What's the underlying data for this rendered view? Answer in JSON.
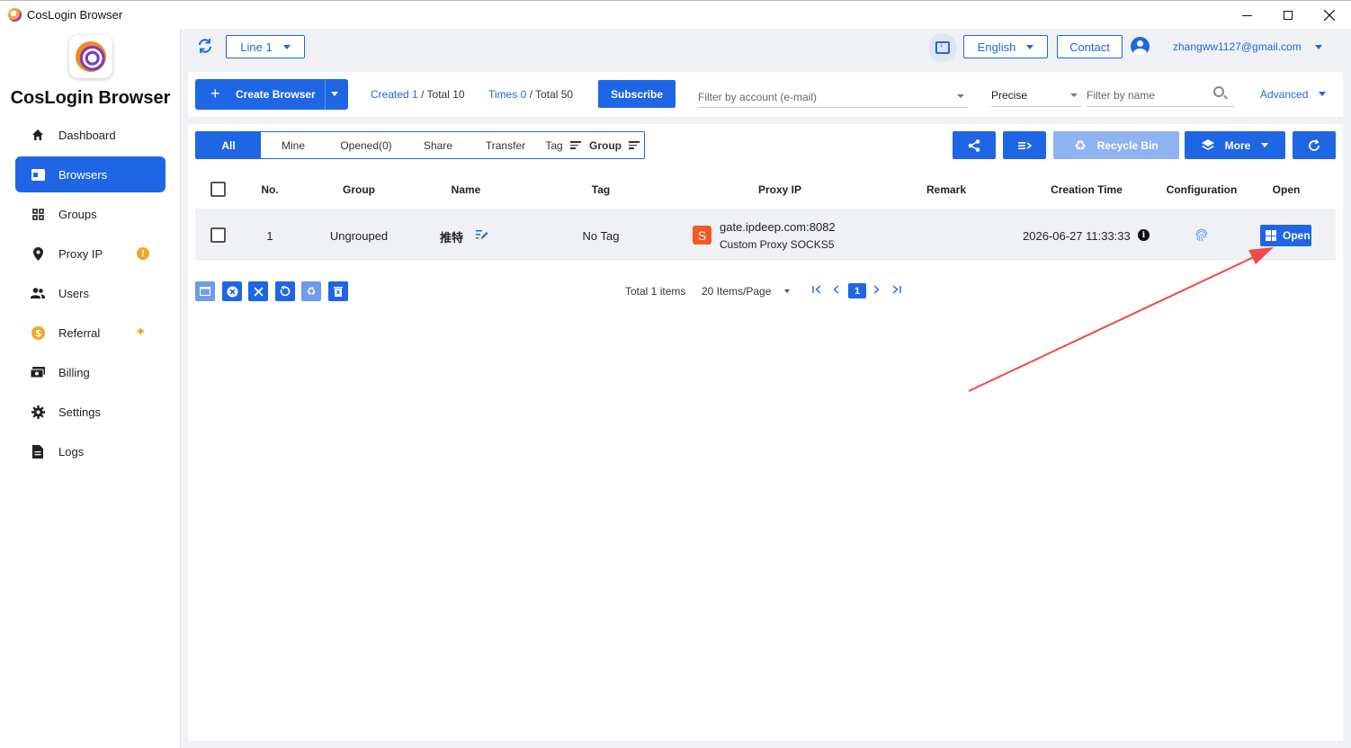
{
  "window": {
    "title": "CosLogin Browser"
  },
  "sidebar": {
    "brand": "CosLogin Browser",
    "items": [
      {
        "label": "Dashboard",
        "icon": "home-icon"
      },
      {
        "label": "Browsers",
        "icon": "browser-window-icon",
        "active": true
      },
      {
        "label": "Groups",
        "icon": "grid-icon"
      },
      {
        "label": "Proxy IP",
        "icon": "location-pin-icon",
        "badge": "!"
      },
      {
        "label": "Users",
        "icon": "users-icon"
      },
      {
        "label": "Referral",
        "icon": "coin-icon",
        "badge": "sparkle"
      },
      {
        "label": "Billing",
        "icon": "money-icon"
      },
      {
        "label": "Settings",
        "icon": "gear-icon"
      },
      {
        "label": "Logs",
        "icon": "document-icon"
      }
    ]
  },
  "header": {
    "line_select": "Line 1",
    "language": "English",
    "contact": "Contact",
    "account": "zhangww1127@gmail.com"
  },
  "toolbar": {
    "create_label": "Create Browser",
    "created_label": "Created",
    "created_value": "1",
    "total_label": "/ Total 10",
    "times_label": "Times",
    "times_value": "0",
    "times_total": "/ Total 50",
    "subscribe_label": "Subscribe",
    "account_filter_placeholder": "Filter by account (e-mail)",
    "match_mode": "Precise",
    "name_filter_placeholder": "Filter by name",
    "advanced_label": "Advanced"
  },
  "tabs": {
    "all": "All",
    "mine": "Mine",
    "opened": "Opened(0)",
    "share": "Share",
    "transfer": "Transfer",
    "tag": "Tag",
    "group": "Group"
  },
  "actions": {
    "recycle_bin": "Recycle Bin",
    "more": "More"
  },
  "table": {
    "headers": {
      "no": "No.",
      "group": "Group",
      "name": "Name",
      "tag": "Tag",
      "proxy_ip": "Proxy IP",
      "remark": "Remark",
      "creation_time": "Creation Time",
      "configuration": "Configuration",
      "open": "Open"
    },
    "rows": [
      {
        "no": "1",
        "group": "Ungrouped",
        "name": "推特",
        "tag": "No Tag",
        "proxy_badge": "S",
        "proxy_host": "gate.ipdeep.com:8082",
        "proxy_type": "Custom Proxy SOCKS5",
        "remark": "",
        "creation_time": "2026-06-27 11:33:33",
        "open_label": "Open"
      }
    ]
  },
  "pagination": {
    "total": "Total 1 items",
    "page_size": "20 Items/Page",
    "current_page": "1"
  },
  "colors": {
    "accent": "#1f66e5",
    "proxy_badge": "#f25a23",
    "warning": "#f2a623",
    "annotation_arrow": "#ef4a43"
  }
}
